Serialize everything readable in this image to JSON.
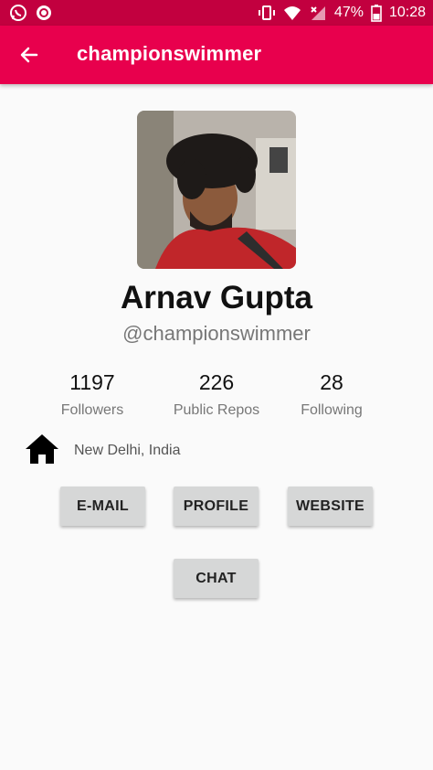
{
  "status_bar": {
    "battery": "47%",
    "time": "10:28",
    "left_icons": [
      "whatsapp-icon",
      "notification-icon"
    ],
    "right_icons": [
      "vibrate-icon",
      "wifi-icon",
      "signal-icon",
      "battery-icon"
    ]
  },
  "app_bar": {
    "title": "championswimmer",
    "back_icon": "arrow-back-icon",
    "color": "#e8004d"
  },
  "profile": {
    "name": "Arnav Gupta",
    "username": "@championswimmer",
    "location": "New Delhi, India",
    "location_icon": "home-icon"
  },
  "stats": [
    {
      "value": "1197",
      "label": "Followers"
    },
    {
      "value": "226",
      "label": "Public Repos"
    },
    {
      "value": "28",
      "label": "Following"
    }
  ],
  "buttons": {
    "email": "E-MAIL",
    "profile": "PROFILE",
    "website": "WEBSITE",
    "chat": "CHAT"
  }
}
